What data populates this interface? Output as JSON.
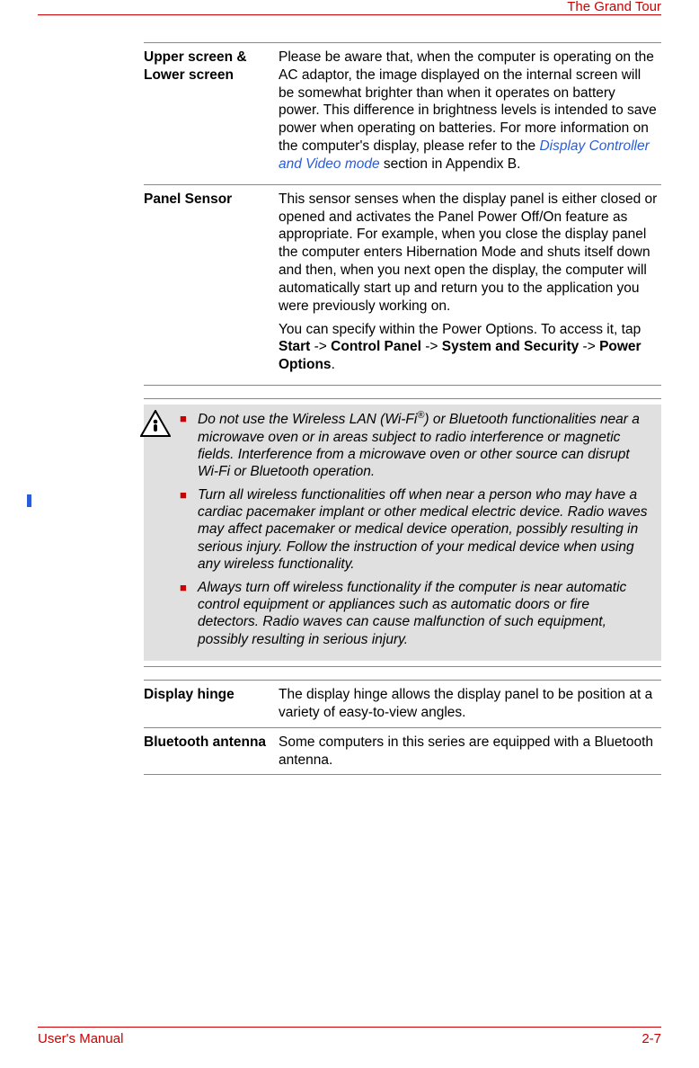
{
  "header": {
    "section_title": "The Grand Tour"
  },
  "table1": {
    "rows": [
      {
        "term": "Upper screen & Lower screen",
        "desc_pre": "Please be aware that, when the computer is operating on the AC adaptor, the image displayed on the internal screen will be somewhat brighter than when it operates on battery power. This difference in brightness levels is intended to save power when operating on batteries. For more information on the computer's display, please refer to the ",
        "desc_link": "Display Controller and Video mode",
        "desc_post": " section in Appendix B."
      },
      {
        "term": "Panel Sensor",
        "p1": "This sensor senses when the display panel is either closed or opened and activates the Panel Power Off/On feature as appropriate. For example, when you close the display panel the computer enters Hibernation Mode and shuts itself down and then, when you next open the display, the computer will automatically start up and return you to the application you were previously working on.",
        "p2_pre": "You can specify within the Power Options. To access it, tap ",
        "p2_b1": "Start",
        "p2_a1": " -> ",
        "p2_b2": "Control Panel",
        "p2_a2": " -> ",
        "p2_b3": "System and Security",
        "p2_a3": " -> ",
        "p2_b4": "Power Options",
        "p2_end": "."
      }
    ]
  },
  "caution": {
    "items": [
      {
        "pre": "Do not use the Wireless LAN (Wi-Fi",
        "sup": "®",
        "post": ") or Bluetooth functionalities near a microwave oven or in areas subject to radio interference or magnetic fields. Interference from a microwave oven or other source can disrupt Wi-Fi or Bluetooth operation."
      },
      {
        "text": "Turn all wireless functionalities off when near a person who may have a cardiac pacemaker implant or other medical electric device. Radio waves may affect pacemaker or medical device operation, possibly resulting in serious injury. Follow the instruction of your medical device when using any wireless functionality."
      },
      {
        "text": "Always turn off wireless functionality if the computer is near automatic control equipment or appliances such as automatic doors or fire detectors. Radio waves can cause malfunction of such equipment, possibly resulting in serious injury."
      }
    ]
  },
  "table2": {
    "rows": [
      {
        "term": "Display hinge",
        "desc": "The display hinge allows the display panel to be position at a variety of easy-to-view angles."
      },
      {
        "term": "Bluetooth antenna",
        "desc": "Some computers in this series are equipped with a Bluetooth antenna."
      }
    ]
  },
  "footer": {
    "left": "User's Manual",
    "right": "2-7"
  }
}
